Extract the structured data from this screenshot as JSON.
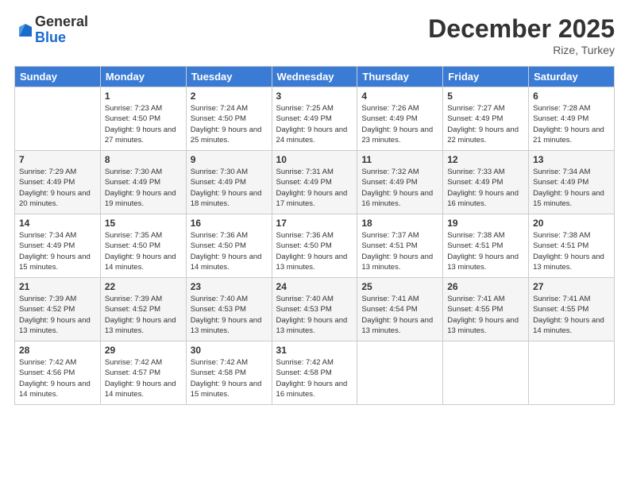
{
  "logo": {
    "general": "General",
    "blue": "Blue"
  },
  "title": "December 2025",
  "location": "Rize, Turkey",
  "days_of_week": [
    "Sunday",
    "Monday",
    "Tuesday",
    "Wednesday",
    "Thursday",
    "Friday",
    "Saturday"
  ],
  "weeks": [
    [
      {
        "day": "",
        "sunrise": "",
        "sunset": "",
        "daylight": ""
      },
      {
        "day": "1",
        "sunrise": "Sunrise: 7:23 AM",
        "sunset": "Sunset: 4:50 PM",
        "daylight": "Daylight: 9 hours and 27 minutes."
      },
      {
        "day": "2",
        "sunrise": "Sunrise: 7:24 AM",
        "sunset": "Sunset: 4:50 PM",
        "daylight": "Daylight: 9 hours and 25 minutes."
      },
      {
        "day": "3",
        "sunrise": "Sunrise: 7:25 AM",
        "sunset": "Sunset: 4:49 PM",
        "daylight": "Daylight: 9 hours and 24 minutes."
      },
      {
        "day": "4",
        "sunrise": "Sunrise: 7:26 AM",
        "sunset": "Sunset: 4:49 PM",
        "daylight": "Daylight: 9 hours and 23 minutes."
      },
      {
        "day": "5",
        "sunrise": "Sunrise: 7:27 AM",
        "sunset": "Sunset: 4:49 PM",
        "daylight": "Daylight: 9 hours and 22 minutes."
      },
      {
        "day": "6",
        "sunrise": "Sunrise: 7:28 AM",
        "sunset": "Sunset: 4:49 PM",
        "daylight": "Daylight: 9 hours and 21 minutes."
      }
    ],
    [
      {
        "day": "7",
        "sunrise": "Sunrise: 7:29 AM",
        "sunset": "Sunset: 4:49 PM",
        "daylight": "Daylight: 9 hours and 20 minutes."
      },
      {
        "day": "8",
        "sunrise": "Sunrise: 7:30 AM",
        "sunset": "Sunset: 4:49 PM",
        "daylight": "Daylight: 9 hours and 19 minutes."
      },
      {
        "day": "9",
        "sunrise": "Sunrise: 7:30 AM",
        "sunset": "Sunset: 4:49 PM",
        "daylight": "Daylight: 9 hours and 18 minutes."
      },
      {
        "day": "10",
        "sunrise": "Sunrise: 7:31 AM",
        "sunset": "Sunset: 4:49 PM",
        "daylight": "Daylight: 9 hours and 17 minutes."
      },
      {
        "day": "11",
        "sunrise": "Sunrise: 7:32 AM",
        "sunset": "Sunset: 4:49 PM",
        "daylight": "Daylight: 9 hours and 16 minutes."
      },
      {
        "day": "12",
        "sunrise": "Sunrise: 7:33 AM",
        "sunset": "Sunset: 4:49 PM",
        "daylight": "Daylight: 9 hours and 16 minutes."
      },
      {
        "day": "13",
        "sunrise": "Sunrise: 7:34 AM",
        "sunset": "Sunset: 4:49 PM",
        "daylight": "Daylight: 9 hours and 15 minutes."
      }
    ],
    [
      {
        "day": "14",
        "sunrise": "Sunrise: 7:34 AM",
        "sunset": "Sunset: 4:49 PM",
        "daylight": "Daylight: 9 hours and 15 minutes."
      },
      {
        "day": "15",
        "sunrise": "Sunrise: 7:35 AM",
        "sunset": "Sunset: 4:50 PM",
        "daylight": "Daylight: 9 hours and 14 minutes."
      },
      {
        "day": "16",
        "sunrise": "Sunrise: 7:36 AM",
        "sunset": "Sunset: 4:50 PM",
        "daylight": "Daylight: 9 hours and 14 minutes."
      },
      {
        "day": "17",
        "sunrise": "Sunrise: 7:36 AM",
        "sunset": "Sunset: 4:50 PM",
        "daylight": "Daylight: 9 hours and 13 minutes."
      },
      {
        "day": "18",
        "sunrise": "Sunrise: 7:37 AM",
        "sunset": "Sunset: 4:51 PM",
        "daylight": "Daylight: 9 hours and 13 minutes."
      },
      {
        "day": "19",
        "sunrise": "Sunrise: 7:38 AM",
        "sunset": "Sunset: 4:51 PM",
        "daylight": "Daylight: 9 hours and 13 minutes."
      },
      {
        "day": "20",
        "sunrise": "Sunrise: 7:38 AM",
        "sunset": "Sunset: 4:51 PM",
        "daylight": "Daylight: 9 hours and 13 minutes."
      }
    ],
    [
      {
        "day": "21",
        "sunrise": "Sunrise: 7:39 AM",
        "sunset": "Sunset: 4:52 PM",
        "daylight": "Daylight: 9 hours and 13 minutes."
      },
      {
        "day": "22",
        "sunrise": "Sunrise: 7:39 AM",
        "sunset": "Sunset: 4:52 PM",
        "daylight": "Daylight: 9 hours and 13 minutes."
      },
      {
        "day": "23",
        "sunrise": "Sunrise: 7:40 AM",
        "sunset": "Sunset: 4:53 PM",
        "daylight": "Daylight: 9 hours and 13 minutes."
      },
      {
        "day": "24",
        "sunrise": "Sunrise: 7:40 AM",
        "sunset": "Sunset: 4:53 PM",
        "daylight": "Daylight: 9 hours and 13 minutes."
      },
      {
        "day": "25",
        "sunrise": "Sunrise: 7:41 AM",
        "sunset": "Sunset: 4:54 PM",
        "daylight": "Daylight: 9 hours and 13 minutes."
      },
      {
        "day": "26",
        "sunrise": "Sunrise: 7:41 AM",
        "sunset": "Sunset: 4:55 PM",
        "daylight": "Daylight: 9 hours and 13 minutes."
      },
      {
        "day": "27",
        "sunrise": "Sunrise: 7:41 AM",
        "sunset": "Sunset: 4:55 PM",
        "daylight": "Daylight: 9 hours and 14 minutes."
      }
    ],
    [
      {
        "day": "28",
        "sunrise": "Sunrise: 7:42 AM",
        "sunset": "Sunset: 4:56 PM",
        "daylight": "Daylight: 9 hours and 14 minutes."
      },
      {
        "day": "29",
        "sunrise": "Sunrise: 7:42 AM",
        "sunset": "Sunset: 4:57 PM",
        "daylight": "Daylight: 9 hours and 14 minutes."
      },
      {
        "day": "30",
        "sunrise": "Sunrise: 7:42 AM",
        "sunset": "Sunset: 4:58 PM",
        "daylight": "Daylight: 9 hours and 15 minutes."
      },
      {
        "day": "31",
        "sunrise": "Sunrise: 7:42 AM",
        "sunset": "Sunset: 4:58 PM",
        "daylight": "Daylight: 9 hours and 16 minutes."
      },
      {
        "day": "",
        "sunrise": "",
        "sunset": "",
        "daylight": ""
      },
      {
        "day": "",
        "sunrise": "",
        "sunset": "",
        "daylight": ""
      },
      {
        "day": "",
        "sunrise": "",
        "sunset": "",
        "daylight": ""
      }
    ]
  ]
}
